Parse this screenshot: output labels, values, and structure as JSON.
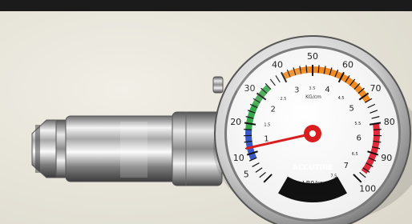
{
  "photo": {
    "subject": "dial tire pressure gauge with chrome body",
    "background_color": "#e9e6dc",
    "top_strip_color": "#1b1b1b"
  },
  "gauge": {
    "brand": "ACCUTIRE",
    "model": "LB9/□",
    "origin": "MADE IN TAIWAN",
    "unit_inner": "KG/cm",
    "outer_scale": {
      "labels": [
        "5",
        "10",
        "20",
        "30",
        "40",
        "50",
        "60",
        "70",
        "80",
        "90",
        "100"
      ]
    },
    "inner_scale": {
      "labels": [
        "1",
        "1.5",
        "2",
        "2.5",
        "3",
        "3.5",
        "4",
        "4.5",
        "5",
        "5.5",
        "6",
        "6.5",
        "7",
        "7.5"
      ]
    },
    "needle_reading_psi": 12,
    "colors": {
      "blue_band": "#3a59c9",
      "green_band": "#38a64a",
      "orange_band": "#f08a22",
      "red_band": "#e02a3a",
      "needle": "#d81e1e",
      "black_band": "#111111"
    }
  }
}
